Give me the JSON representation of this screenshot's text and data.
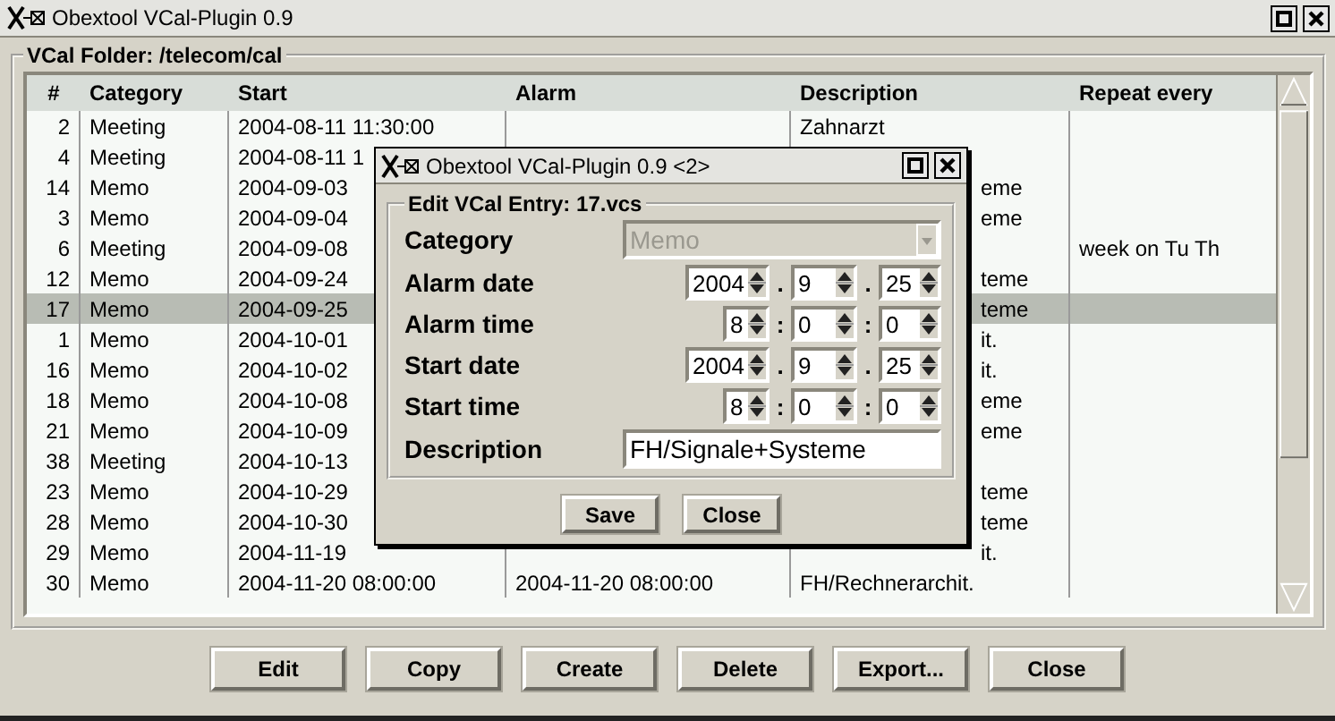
{
  "window": {
    "title": "Obextool VCal-Plugin 0.9"
  },
  "folder": {
    "label": "VCal Folder: /telecom/cal"
  },
  "table": {
    "columns": [
      "#",
      "Category",
      "Start",
      "Alarm",
      "Description",
      "Repeat every"
    ],
    "rows": [
      {
        "number": "2",
        "category": "Meeting",
        "start": "2004-08-11 11:30:00",
        "description": "Zahnarzt",
        "selected": false,
        "description_cut": false
      },
      {
        "number": "4",
        "category": "Meeting",
        "start": "2004-08-11 1",
        "selected": false,
        "description_cut": false
      },
      {
        "number": "14",
        "category": "Memo",
        "start": "2004-09-03",
        "description": "eme",
        "selected": false,
        "description_cut": true
      },
      {
        "number": "3",
        "category": "Memo",
        "start": "2004-09-04",
        "description": "eme",
        "selected": false,
        "description_cut": true
      },
      {
        "number": "6",
        "category": "Meeting",
        "start": "2004-09-08",
        "repeat_every": "week on Tu Th",
        "selected": false,
        "description_cut": false
      },
      {
        "number": "12",
        "category": "Memo",
        "start": "2004-09-24",
        "description": "teme",
        "selected": false,
        "description_cut": true
      },
      {
        "number": "17",
        "category": "Memo",
        "start": "2004-09-25",
        "description": "teme",
        "selected": true,
        "description_cut": true
      },
      {
        "number": "1",
        "category": "Memo",
        "start": "2004-10-01",
        "description": "it.",
        "selected": false,
        "description_cut": true
      },
      {
        "number": "16",
        "category": "Memo",
        "start": "2004-10-02",
        "description": "it.",
        "selected": false,
        "description_cut": true
      },
      {
        "number": "18",
        "category": "Memo",
        "start": "2004-10-08",
        "description": "eme",
        "selected": false,
        "description_cut": true
      },
      {
        "number": "21",
        "category": "Memo",
        "start": "2004-10-09",
        "description": "eme",
        "selected": false,
        "description_cut": true
      },
      {
        "number": "38",
        "category": "Meeting",
        "start": "2004-10-13",
        "selected": false,
        "description_cut": false
      },
      {
        "number": "23",
        "category": "Memo",
        "start": "2004-10-29",
        "description": "teme",
        "selected": false,
        "description_cut": true
      },
      {
        "number": "28",
        "category": "Memo",
        "start": "2004-10-30",
        "description": "teme",
        "selected": false,
        "description_cut": true
      },
      {
        "number": "29",
        "category": "Memo",
        "start": "2004-11-19",
        "description": "it.",
        "selected": false,
        "description_cut": true
      },
      {
        "number": "30",
        "category": "Memo",
        "start": "2004-11-20 08:00:00",
        "alarm": "2004-11-20 08:00:00",
        "description": "FH/Rechnerarchit.",
        "selected": false,
        "description_cut": false
      }
    ]
  },
  "buttons": [
    {
      "label": "Edit"
    },
    {
      "label": "Copy"
    },
    {
      "label": "Create"
    },
    {
      "label": "Delete"
    },
    {
      "label": "Export..."
    },
    {
      "label": "Close"
    }
  ],
  "dialog": {
    "title": "Obextool VCal-Plugin 0.9 <2>",
    "group_label": "Edit VCal Entry: 17.vcs",
    "fields": [
      {
        "kind": "combo",
        "label": "Category",
        "value": "Memo",
        "disabled": true
      },
      {
        "kind": "date",
        "label": "Alarm date",
        "parts": [
          "2004",
          "9",
          "25"
        ],
        "separators": [
          ".",
          "."
        ]
      },
      {
        "kind": "time",
        "label": "Alarm time",
        "parts": [
          "8",
          "0",
          "0"
        ],
        "separators": [
          ":",
          ":"
        ]
      },
      {
        "kind": "date",
        "label": "Start date",
        "parts": [
          "2004",
          "9",
          "25"
        ],
        "separators": [
          ".",
          "."
        ]
      },
      {
        "kind": "time",
        "label": "Start time",
        "parts": [
          "8",
          "0",
          "0"
        ],
        "separators": [
          ":",
          ":"
        ]
      },
      {
        "kind": "text",
        "label": "Description",
        "value": "FH/Signale+Systeme"
      }
    ],
    "buttons": [
      {
        "label": "Save"
      },
      {
        "label": "Close"
      }
    ]
  }
}
